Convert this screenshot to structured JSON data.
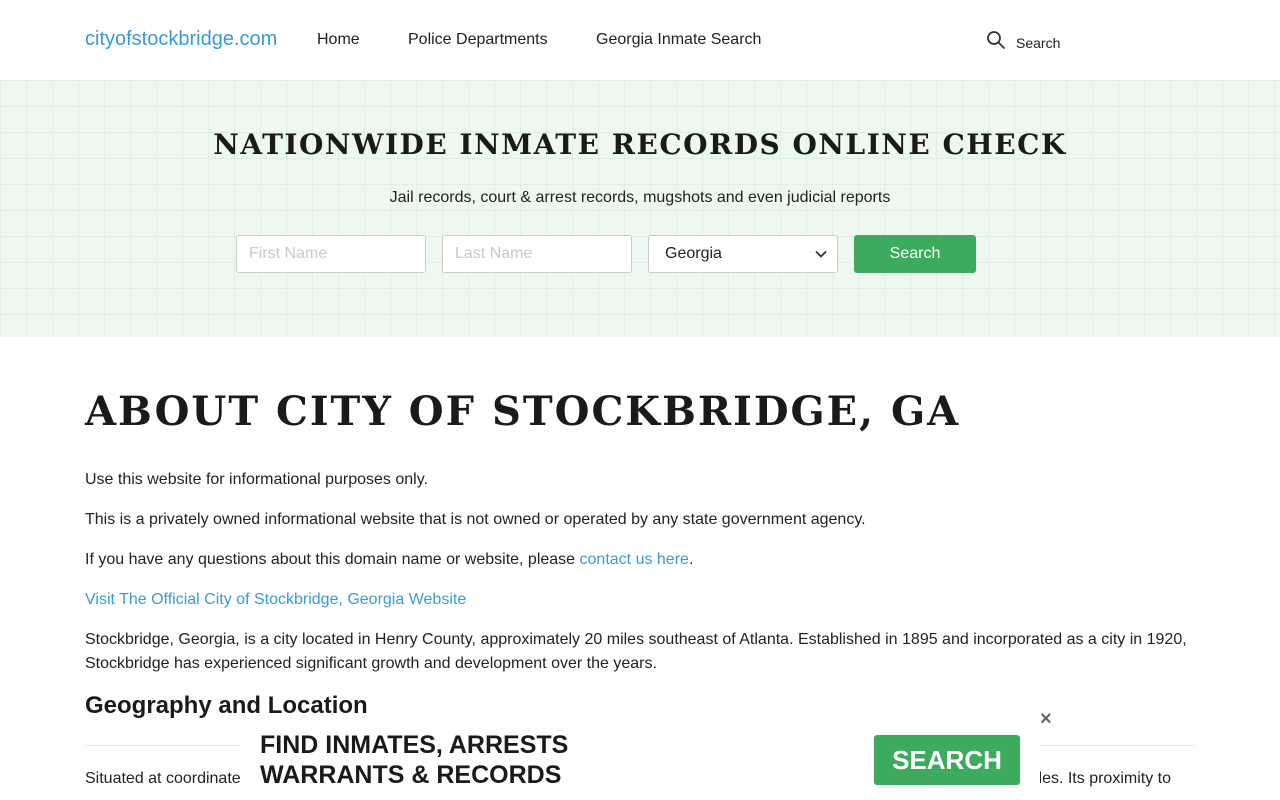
{
  "header": {
    "logo": "cityofstockbridge.com",
    "nav": [
      {
        "label": "Home"
      },
      {
        "label": "Police Departments"
      },
      {
        "label": "Georgia Inmate Search"
      }
    ],
    "search_label": "Search"
  },
  "hero": {
    "title": "NATIONWIDE INMATE RECORDS ONLINE CHECK",
    "subtitle": "Jail records, court & arrest records, mugshots and even judicial reports",
    "first_name_placeholder": "First Name",
    "last_name_placeholder": "Last Name",
    "state_selected": "Georgia",
    "search_button": "Search"
  },
  "main": {
    "title": "ABOUT CITY OF STOCKBRIDGE, GA",
    "p1": "Use this website for informational purposes only.",
    "p2": "This is a privately owned informational website that is not owned or operated by any state government agency.",
    "p3_text": "If you have any questions about this domain name or website, please ",
    "p3_link": "contact us here",
    "p3_end": ".",
    "official_link": "Visit The Official City of Stockbridge, Georgia Website",
    "p4": "Stockbridge, Georgia, is a city located in Henry County, approximately 20 miles southeast of Atlanta. Established in 1895 and incorporated as a city in 1920, Stockbridge has experienced significant growth and development over the years.",
    "section_title": "Geography and Location",
    "cut_left": "Situated at coordinate",
    "cut_right": "les. Its proximity to"
  },
  "banner": {
    "line1": "FIND INMATES, ARRESTS",
    "line2": "WARRANTS & RECORDS",
    "button": "SEARCH",
    "close": "×"
  },
  "colors": {
    "link": "#3a9ad9",
    "button_green": "#3dab5e",
    "hero_bg": "#eef8f1"
  }
}
